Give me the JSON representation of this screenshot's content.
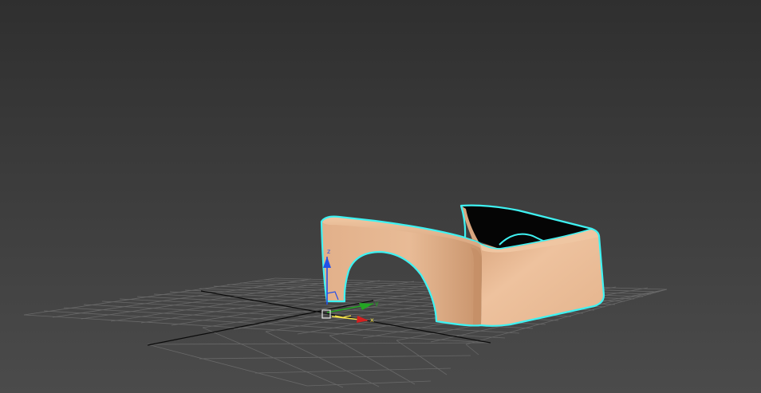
{
  "viewport": {
    "colors": {
      "background_top": "#2f2f2f",
      "background_bottom": "#4b4b4b",
      "grid_line": "#686868",
      "grid_axis": "#0b0b0b",
      "selection_outline": "#3ff2f2",
      "surface_base": "#e6b690",
      "surface_shadow": "#c8936b",
      "interior": "#050505"
    },
    "selected_object": {
      "name": "",
      "selected": true
    }
  },
  "gizmo": {
    "x_label": "x",
    "y_label": "y",
    "z_label": "z",
    "colors": {
      "x": "#d41f1f",
      "y": "#23a623",
      "z": "#2450e8",
      "highlight": "#f2e04a",
      "center_box": "#e6e6e6"
    }
  }
}
